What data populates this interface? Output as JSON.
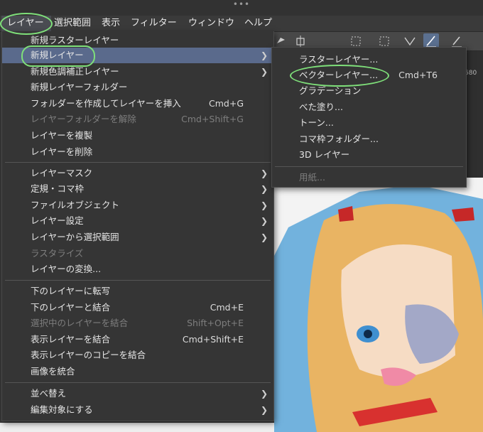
{
  "window": {
    "dots": "•••"
  },
  "menubar": {
    "items": [
      {
        "label": "レイヤー"
      },
      {
        "label": "選択範囲"
      },
      {
        "label": "表示"
      },
      {
        "label": "フィルター"
      },
      {
        "label": "ウィンドウ"
      },
      {
        "label": "ヘルプ"
      }
    ]
  },
  "ruler": {
    "tick_label": "680"
  },
  "layer_menu": {
    "items": [
      {
        "label": "新規ラスターレイヤー",
        "shortcut": ""
      },
      {
        "label": "新規レイヤー",
        "shortcut": ""
      },
      {
        "label": "新規色調補正レイヤー",
        "shortcut": ""
      },
      {
        "label": "新規レイヤーフォルダー",
        "shortcut": ""
      },
      {
        "label": "フォルダーを作成してレイヤーを挿入",
        "shortcut": "Cmd+G"
      },
      {
        "label": "レイヤーフォルダーを解除",
        "shortcut": "Cmd+Shift+G"
      },
      {
        "label": "レイヤーを複製",
        "shortcut": ""
      },
      {
        "label": "レイヤーを削除",
        "shortcut": ""
      },
      {
        "label": "レイヤーマスク",
        "shortcut": ""
      },
      {
        "label": "定規・コマ枠",
        "shortcut": ""
      },
      {
        "label": "ファイルオブジェクト",
        "shortcut": ""
      },
      {
        "label": "レイヤー設定",
        "shortcut": ""
      },
      {
        "label": "レイヤーから選択範囲",
        "shortcut": ""
      },
      {
        "label": "ラスタライズ",
        "shortcut": ""
      },
      {
        "label": "レイヤーの変換...",
        "shortcut": ""
      },
      {
        "label": "下のレイヤーに転写",
        "shortcut": ""
      },
      {
        "label": "下のレイヤーと結合",
        "shortcut": "Cmd+E"
      },
      {
        "label": "選択中のレイヤーを結合",
        "shortcut": "Shift+Opt+E"
      },
      {
        "label": "表示レイヤーを結合",
        "shortcut": "Cmd+Shift+E"
      },
      {
        "label": "表示レイヤーのコピーを結合",
        "shortcut": ""
      },
      {
        "label": "画像を統合",
        "shortcut": ""
      },
      {
        "label": "並べ替え",
        "shortcut": ""
      },
      {
        "label": "編集対象にする",
        "shortcut": ""
      }
    ]
  },
  "new_layer_submenu": {
    "items": [
      {
        "label": "ラスターレイヤー...",
        "shortcut": ""
      },
      {
        "label": "ベクターレイヤー...",
        "shortcut": "Cmd+T6"
      },
      {
        "label": "グラデーション",
        "shortcut": ""
      },
      {
        "label": "べた塗り...",
        "shortcut": ""
      },
      {
        "label": "トーン...",
        "shortcut": ""
      },
      {
        "label": "コマ枠フォルダー...",
        "shortcut": ""
      },
      {
        "label": "3D レイヤー",
        "shortcut": ""
      },
      {
        "label": "用紙...",
        "shortcut": ""
      }
    ]
  },
  "colors": {
    "highlight": "#5a6a8c",
    "annotation_ring": "#7fe07a"
  }
}
